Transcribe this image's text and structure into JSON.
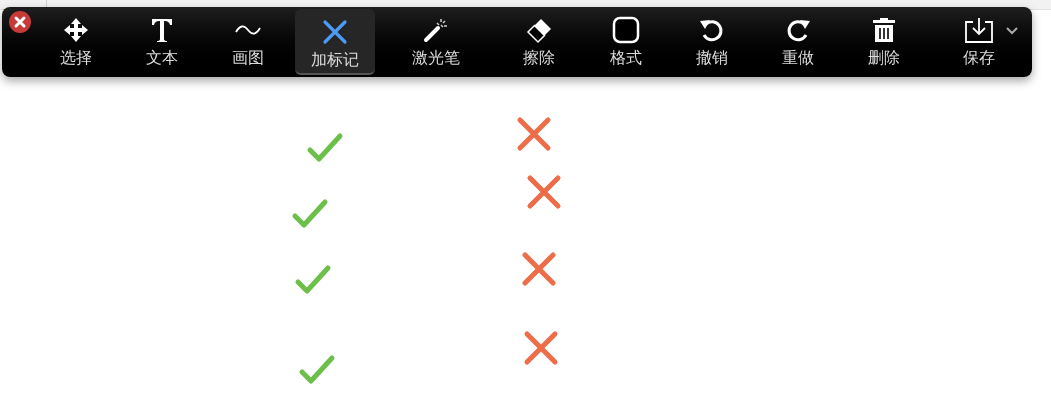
{
  "toolbar": {
    "tools": [
      {
        "kind": "move",
        "label": "选择",
        "selected": false
      },
      {
        "kind": "text",
        "label": "文本",
        "selected": false
      },
      {
        "kind": "draw",
        "label": "画图",
        "selected": false
      },
      {
        "kind": "stamp",
        "label": "加标记",
        "selected": true
      },
      {
        "kind": "laser",
        "label": "激光笔",
        "selected": false
      },
      {
        "kind": "eraser",
        "label": "擦除",
        "selected": false
      },
      {
        "kind": "format",
        "label": "格式",
        "selected": false
      },
      {
        "kind": "undo",
        "label": "撤销",
        "selected": false
      },
      {
        "kind": "redo",
        "label": "重做",
        "selected": false
      },
      {
        "kind": "delete",
        "label": "删除",
        "selected": false
      },
      {
        "kind": "save",
        "label": "保存",
        "selected": false
      }
    ]
  },
  "marks": [
    {
      "kind": "check"
    },
    {
      "kind": "check"
    },
    {
      "kind": "check"
    },
    {
      "kind": "check"
    },
    {
      "kind": "cross"
    },
    {
      "kind": "cross"
    },
    {
      "kind": "cross"
    },
    {
      "kind": "cross"
    }
  ]
}
